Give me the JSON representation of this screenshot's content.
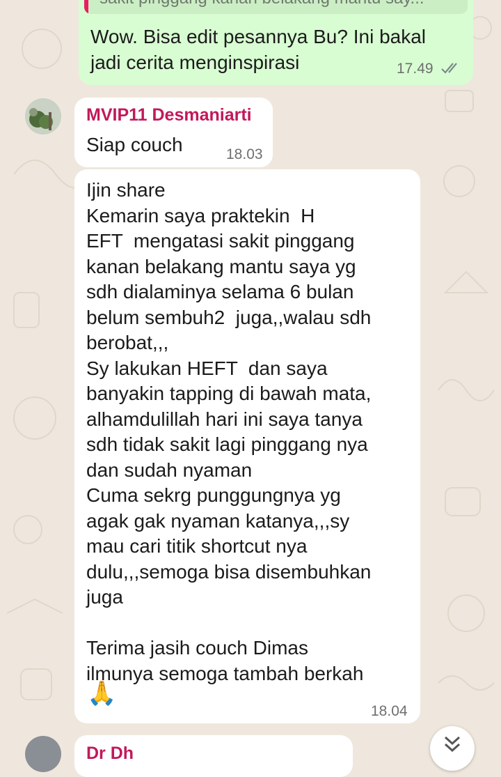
{
  "colors": {
    "outgoing_bubble": "#d8fdd2",
    "incoming_bubble": "#ffffff",
    "sender_name": "#c2185b",
    "quote_bar": "#e91e63",
    "read_ticks": "#7a8a8a"
  },
  "quoted_reply": {
    "text": "sakit pinggang kanan belakang mantu say..."
  },
  "messages": [
    {
      "direction": "outgoing",
      "text": "Wow. Bisa edit pesannya Bu? Ini bakal\njadi cerita menginspirasi",
      "time": "17.49",
      "status_icon": "double-check-icon"
    },
    {
      "direction": "incoming",
      "sender": "MVIP11 Desmaniarti",
      "text": "Siap couch",
      "time": "18.03"
    },
    {
      "direction": "incoming",
      "text": "Ijin share\nKemarin saya praktekin  H\nEFT  mengatasi sakit pinggang\nkanan belakang mantu saya yg\nsdh dialaminya selama 6 bulan\nbelum sembuh2  juga,,walau sdh\nberobat,,,\nSy lakukan HEFT  dan saya\nbanyakin tapping di bawah mata,\nalhamdulillah hari ini saya tanya\nsdh tidak sakit lagi pinggang nya\ndan sudah nyaman\nCuma sekrg punggungnya yg\nagak gak nyaman katanya,,,sy\nmau cari titik shortcut nya\ndulu,,,semoga bisa disembuhkan\njuga\n\nTerima jasih couch Dimas\nilmunya semoga tambah berkah",
      "emoji": "🙏",
      "time": "18.04"
    }
  ],
  "next_message_partial": {
    "sender": "Dr Dh"
  },
  "scroll_button": {
    "icon": "double-chevron-down-icon"
  }
}
